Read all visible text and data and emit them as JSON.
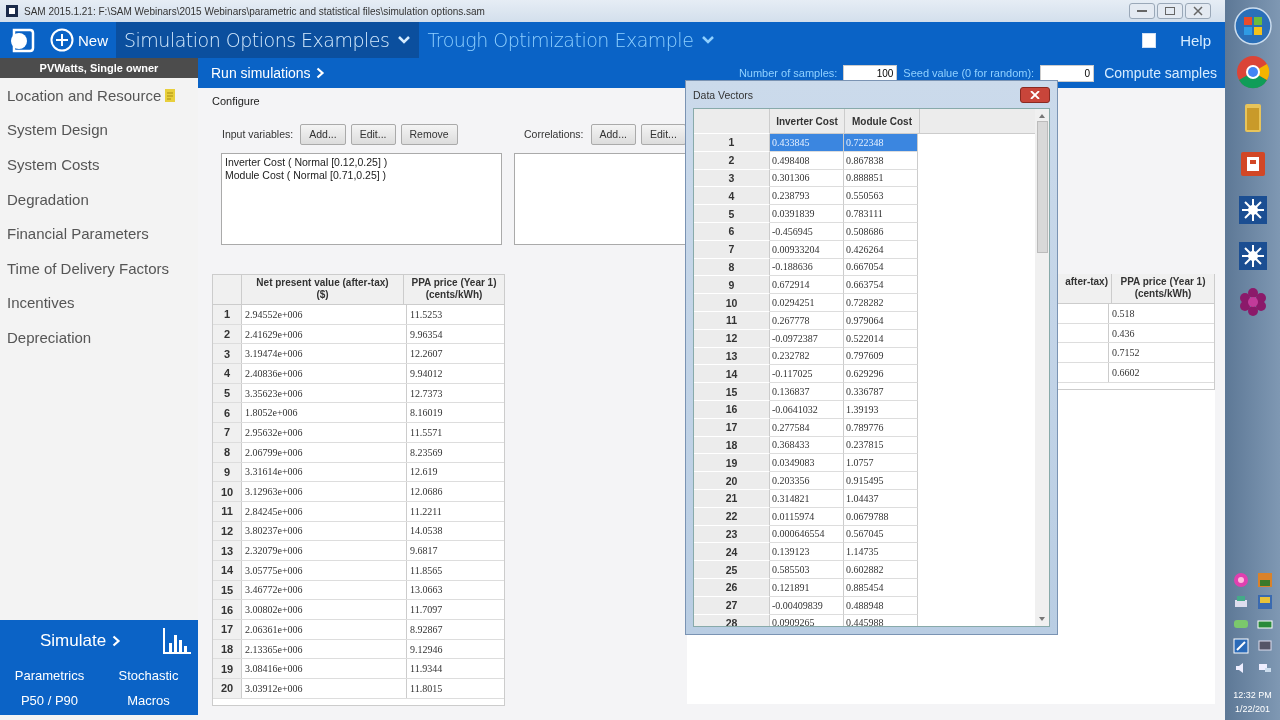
{
  "window": {
    "title": "SAM 2015.1.21: F:\\SAM Webinars\\2015 Webinars\\parametric and statistical files\\simulation options.sam"
  },
  "header": {
    "new_label": "New",
    "tabs": [
      {
        "label": "Simulation Options Examples",
        "selected": true
      },
      {
        "label": "Trough Optimization Example",
        "selected": false
      }
    ],
    "help_checked": false,
    "help_label": "Help"
  },
  "sidebar": {
    "config": "PVWatts, Single owner",
    "items": [
      {
        "label": "Location and Resource",
        "note": true
      },
      {
        "label": "System Design",
        "note": false
      },
      {
        "label": "System Costs",
        "note": false
      },
      {
        "label": "Degradation",
        "note": false
      },
      {
        "label": "Financial Parameters",
        "note": false
      },
      {
        "label": "Time of Delivery Factors",
        "note": false
      },
      {
        "label": "Incentives",
        "note": false
      },
      {
        "label": "Depreciation",
        "note": false
      }
    ],
    "simulate": "Simulate",
    "links": [
      "Parametrics",
      "Stochastic",
      "P50 / P90",
      "Macros"
    ]
  },
  "toolbar": {
    "run": "Run simulations",
    "samples_label": "Number of samples:",
    "samples_value": "100",
    "seed_label": "Seed value (0 for random):",
    "seed_value": "0",
    "compute": "Compute samples"
  },
  "configure": {
    "title": "Configure",
    "input_label": "Input variables:",
    "input_buttons": [
      "Add...",
      "Edit...",
      "Remove"
    ],
    "input_list": [
      "Inverter Cost ( Normal [0.12,0.25] )",
      "Module Cost ( Normal [0.71,0.25] )"
    ],
    "correlations_label": "Correlations:",
    "correlation_buttons": [
      "Add...",
      "Edit..."
    ]
  },
  "results_table": {
    "columns": [
      "",
      "Net present value (after-tax)\n($)",
      "PPA price (Year 1)\n(cents/kWh)"
    ],
    "rows": [
      [
        "1",
        "2.94552e+006",
        "11.5253"
      ],
      [
        "2",
        "2.41629e+006",
        "9.96354"
      ],
      [
        "3",
        "3.19474e+006",
        "12.2607"
      ],
      [
        "4",
        "2.40836e+006",
        "9.94012"
      ],
      [
        "5",
        "3.35623e+006",
        "12.7373"
      ],
      [
        "6",
        "1.8052e+006",
        "8.16019"
      ],
      [
        "7",
        "2.95632e+006",
        "11.5571"
      ],
      [
        "8",
        "2.06799e+006",
        "8.23569"
      ],
      [
        "9",
        "3.31614e+006",
        "12.619"
      ],
      [
        "10",
        "3.12963e+006",
        "12.0686"
      ],
      [
        "11",
        "2.84245e+006",
        "11.2211"
      ],
      [
        "12",
        "3.80237e+006",
        "14.0538"
      ],
      [
        "13",
        "2.32079e+006",
        "9.6817"
      ],
      [
        "14",
        "3.05775e+006",
        "11.8565"
      ],
      [
        "15",
        "3.46772e+006",
        "13.0663"
      ],
      [
        "16",
        "3.00802e+006",
        "11.7097"
      ],
      [
        "17",
        "2.06361e+006",
        "8.92867"
      ],
      [
        "18",
        "2.13365e+006",
        "9.12946"
      ],
      [
        "19",
        "3.08416e+006",
        "11.9344"
      ],
      [
        "20",
        "3.03912e+006",
        "11.8015"
      ]
    ]
  },
  "results_table_2": {
    "columns": [
      "after-tax)",
      "PPA price (Year 1)\n(cents/kWh)"
    ],
    "rows": [
      "0.518",
      "0.436",
      "0.7152",
      "0.6602"
    ]
  },
  "dialog": {
    "title": "Data Vectors",
    "columns": [
      "",
      "Inverter Cost",
      "Module Cost"
    ],
    "rows": [
      {
        "n": "1",
        "inverter": "0.433845",
        "module": "0.722348",
        "selected": true
      },
      {
        "n": "2",
        "inverter": "0.498408",
        "module": "0.867838",
        "selected": false
      },
      {
        "n": "3",
        "inverter": "0.301306",
        "module": "0.888851",
        "selected": false
      },
      {
        "n": "4",
        "inverter": "0.238793",
        "module": "0.550563",
        "selected": false
      },
      {
        "n": "5",
        "inverter": "0.0391839",
        "module": "0.783111",
        "selected": false
      },
      {
        "n": "6",
        "inverter": "-0.456945",
        "module": "0.508686",
        "selected": false
      },
      {
        "n": "7",
        "inverter": "0.00933204",
        "module": "0.426264",
        "selected": false
      },
      {
        "n": "8",
        "inverter": "-0.188636",
        "module": "0.667054",
        "selected": false
      },
      {
        "n": "9",
        "inverter": "0.672914",
        "module": "0.663754",
        "selected": false
      },
      {
        "n": "10",
        "inverter": "0.0294251",
        "module": "0.728282",
        "selected": false
      },
      {
        "n": "11",
        "inverter": "0.267778",
        "module": "0.979064",
        "selected": false
      },
      {
        "n": "12",
        "inverter": "-0.0972387",
        "module": "0.522014",
        "selected": false
      },
      {
        "n": "13",
        "inverter": "0.232782",
        "module": "0.797609",
        "selected": false
      },
      {
        "n": "14",
        "inverter": "-0.117025",
        "module": "0.629296",
        "selected": false
      },
      {
        "n": "15",
        "inverter": "0.136837",
        "module": "0.336787",
        "selected": false
      },
      {
        "n": "16",
        "inverter": "-0.0641032",
        "module": "1.39193",
        "selected": false
      },
      {
        "n": "17",
        "inverter": "0.277584",
        "module": "0.789776",
        "selected": false
      },
      {
        "n": "18",
        "inverter": "0.368433",
        "module": "0.237815",
        "selected": false
      },
      {
        "n": "19",
        "inverter": "0.0349083",
        "module": "1.0757",
        "selected": false
      },
      {
        "n": "20",
        "inverter": "0.203356",
        "module": "0.915495",
        "selected": false
      },
      {
        "n": "21",
        "inverter": "0.314821",
        "module": "1.04437",
        "selected": false
      },
      {
        "n": "22",
        "inverter": "0.0115974",
        "module": "0.0679788",
        "selected": false
      },
      {
        "n": "23",
        "inverter": "0.000646554",
        "module": "0.567045",
        "selected": false
      },
      {
        "n": "24",
        "inverter": "0.139123",
        "module": "1.14735",
        "selected": false
      },
      {
        "n": "25",
        "inverter": "0.585503",
        "module": "0.602882",
        "selected": false
      },
      {
        "n": "26",
        "inverter": "0.121891",
        "module": "0.885454",
        "selected": false
      },
      {
        "n": "27",
        "inverter": "-0.00409839",
        "module": "0.488948",
        "selected": false
      },
      {
        "n": "28",
        "inverter": "0.0909265",
        "module": "0.445988",
        "selected": false
      }
    ]
  },
  "taskbar": {
    "time": "12:32 PM",
    "date": "1/22/201"
  }
}
